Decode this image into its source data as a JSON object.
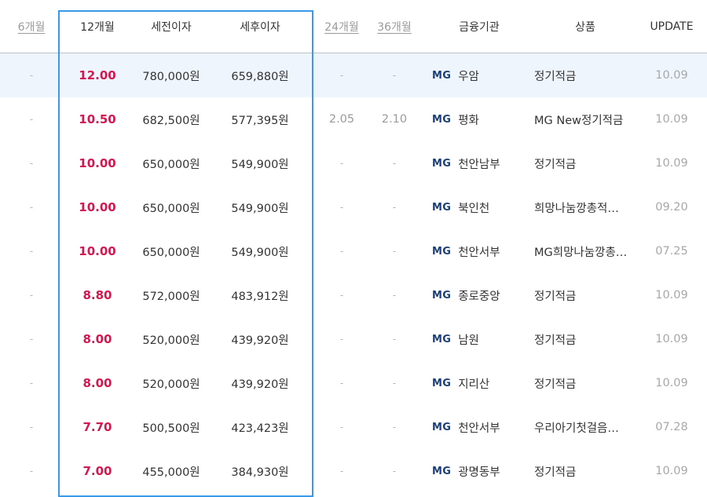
{
  "header": {
    "col_6m": "6개월",
    "col_12m": "12개월",
    "col_pretax": "세전이자",
    "col_aftertax": "세후이자",
    "col_24m": "24개월",
    "col_36m": "36개월",
    "col_bank": "금융기관",
    "col_product": "상품",
    "col_update": "UPDATE"
  },
  "rows": [
    {
      "m6": "-",
      "m12": "12.00",
      "pretax": "780,000원",
      "aftertax": "659,880원",
      "m24": "-",
      "m36": "-",
      "bank_logo": "MG",
      "bank": "우암",
      "product": "정기적금",
      "update": "10.09"
    },
    {
      "m6": "-",
      "m12": "10.50",
      "pretax": "682,500원",
      "aftertax": "577,395원",
      "m24": "2.05",
      "m36": "2.10",
      "bank_logo": "MG",
      "bank": "평화",
      "product": "MG New정기적금",
      "update": "10.09"
    },
    {
      "m6": "-",
      "m12": "10.00",
      "pretax": "650,000원",
      "aftertax": "549,900원",
      "m24": "-",
      "m36": "-",
      "bank_logo": "MG",
      "bank": "천안남부",
      "product": "정기적금",
      "update": "10.09"
    },
    {
      "m6": "-",
      "m12": "10.00",
      "pretax": "650,000원",
      "aftertax": "549,900원",
      "m24": "-",
      "m36": "-",
      "bank_logo": "MG",
      "bank": "북인천",
      "product": "희망나눔깡총적…",
      "update": "09.20"
    },
    {
      "m6": "-",
      "m12": "10.00",
      "pretax": "650,000원",
      "aftertax": "549,900원",
      "m24": "-",
      "m36": "-",
      "bank_logo": "MG",
      "bank": "천안서부",
      "product": "MG희망나눔깡총…",
      "update": "07.25"
    },
    {
      "m6": "-",
      "m12": "8.80",
      "pretax": "572,000원",
      "aftertax": "483,912원",
      "m24": "-",
      "m36": "-",
      "bank_logo": "MG",
      "bank": "종로중앙",
      "product": "정기적금",
      "update": "10.09"
    },
    {
      "m6": "-",
      "m12": "8.00",
      "pretax": "520,000원",
      "aftertax": "439,920원",
      "m24": "-",
      "m36": "-",
      "bank_logo": "MG",
      "bank": "남원",
      "product": "정기적금",
      "update": "10.09"
    },
    {
      "m6": "-",
      "m12": "8.00",
      "pretax": "520,000원",
      "aftertax": "439,920원",
      "m24": "-",
      "m36": "-",
      "bank_logo": "MG",
      "bank": "지리산",
      "product": "정기적금",
      "update": "10.09"
    },
    {
      "m6": "-",
      "m12": "7.70",
      "pretax": "500,500원",
      "aftertax": "423,423원",
      "m24": "-",
      "m36": "-",
      "bank_logo": "MG",
      "bank": "천안서부",
      "product": "우리아기첫걸음…",
      "update": "07.28"
    },
    {
      "m6": "-",
      "m12": "7.00",
      "pretax": "455,000원",
      "aftertax": "384,930원",
      "m24": "-",
      "m36": "-",
      "bank_logo": "MG",
      "bank": "광명동부",
      "product": "정기적금",
      "update": "10.09"
    }
  ],
  "colors": {
    "rate": "#d6174f",
    "highlight_border": "#3a9ae8",
    "selected_row_bg": "#eef5fd",
    "bank_logo": "#1c3f7a"
  }
}
